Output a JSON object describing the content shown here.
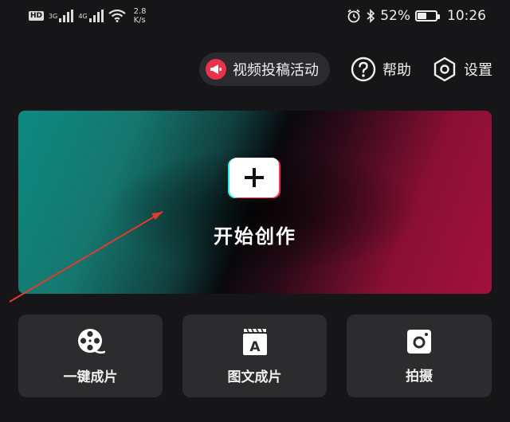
{
  "status_bar": {
    "hd_badge": "HD",
    "net_3g": "3G",
    "net_4g": "4G",
    "speed_value": "2.8",
    "speed_unit": "K/s",
    "battery_percent": "52%",
    "battery_level": 0.52,
    "time": "10:26"
  },
  "top_actions": {
    "activity_label": "视频投稿活动",
    "help_label": "帮助",
    "settings_label": "设置"
  },
  "hero": {
    "title": "开始创作"
  },
  "tiles": [
    {
      "label": "一键成片",
      "icon": "film-reel-icon"
    },
    {
      "label": "图文成片",
      "icon": "text-template-icon"
    },
    {
      "label": "拍摄",
      "icon": "camera-icon"
    }
  ],
  "colors": {
    "background": "#161618",
    "tile": "#2c2c2e",
    "accent_red": "#fe2c55",
    "accent_cyan": "#25f4ee",
    "annotation_arrow": "#e33a2c"
  }
}
